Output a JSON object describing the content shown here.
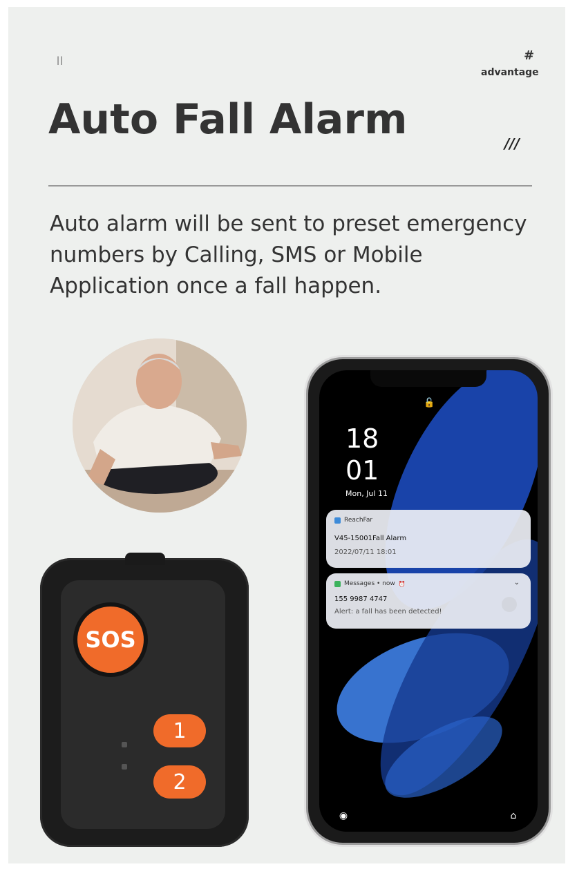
{
  "header": {
    "corner_mark": "||",
    "hash": "#",
    "tag": "advantage",
    "title": "Auto Fall Alarm",
    "slashes": "///"
  },
  "description": "Auto alarm will be sent to preset emergency numbers by Calling, SMS or Mobile Application once a fall happen.",
  "device": {
    "sos_label": "SOS",
    "button_1": "1",
    "button_2": "2"
  },
  "phone": {
    "time_hour": "18",
    "time_minute": "01",
    "date": "Mon, Jul 11",
    "notification_1": {
      "app": "ReachFar",
      "title": "V45-15001Fall Alarm",
      "time": "2022/07/11 18:01"
    },
    "notification_2": {
      "app": "Messages • now",
      "number": "155 9987 4747",
      "message": "Alert: a fall has been detected!"
    }
  },
  "colors": {
    "accent_orange": "#f06b2a",
    "background": "#eef0ee",
    "title_text": "#333333"
  },
  "icons": [
    "lock-icon",
    "flashlight-icon",
    "camera-icon",
    "chevron-down-icon",
    "alarm-bell-icon"
  ]
}
